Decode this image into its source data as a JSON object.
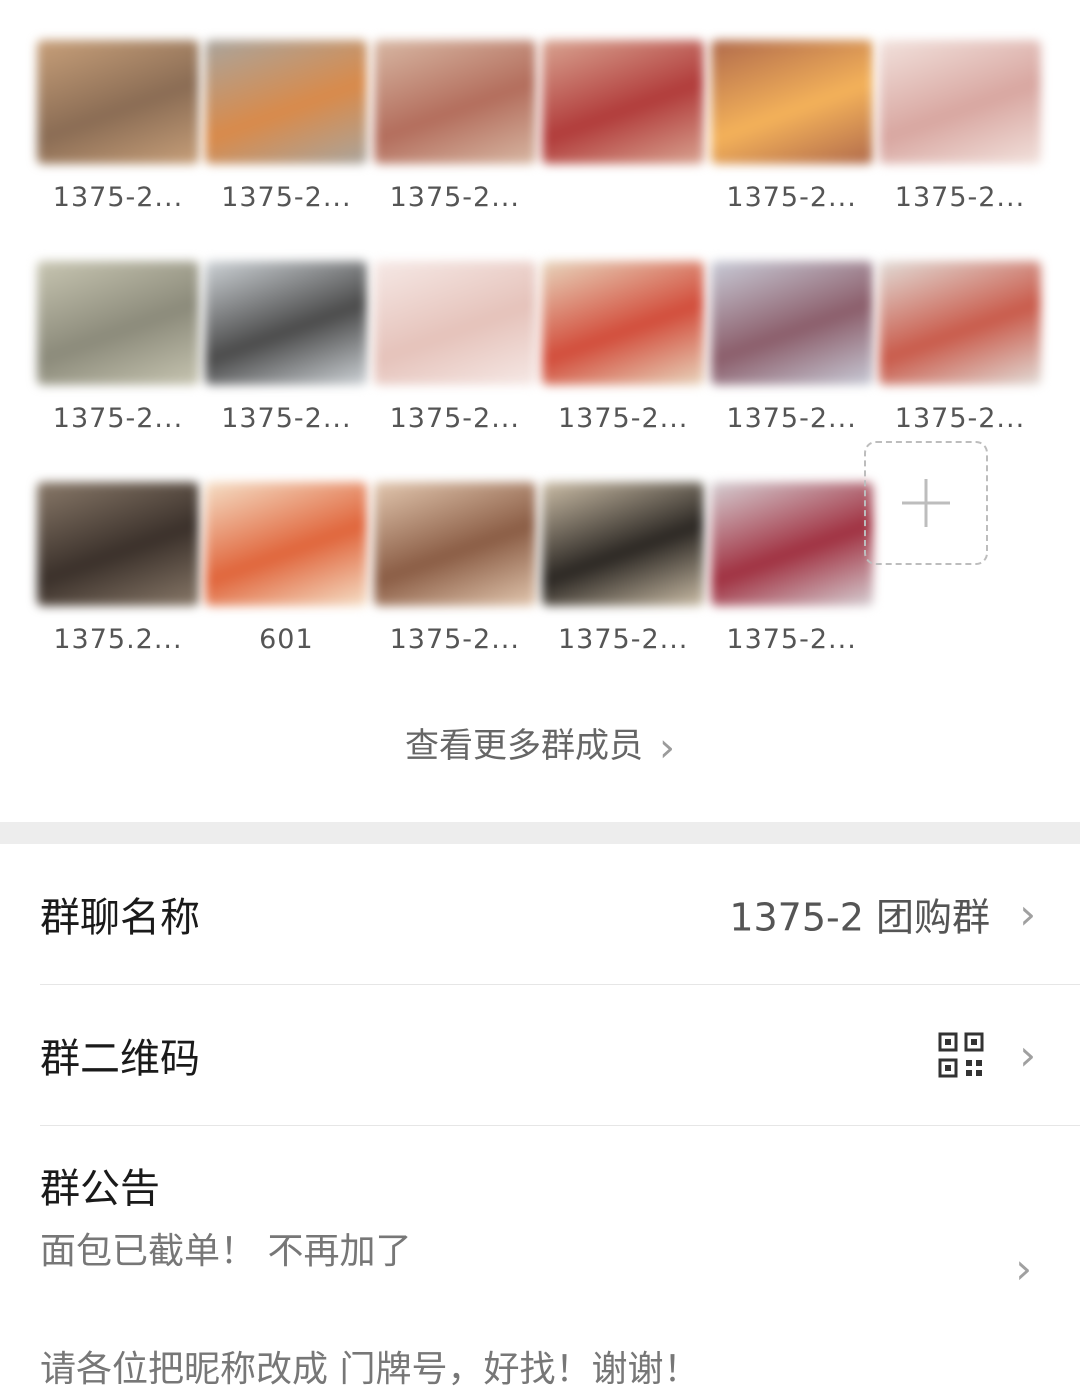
{
  "members": [
    {
      "name": "1375-2...",
      "colors": [
        "#c8a07a",
        "#8a6c54"
      ]
    },
    {
      "name": "1375-2...",
      "colors": [
        "#a9a59e",
        "#d98a4a"
      ]
    },
    {
      "name": "1375-2...",
      "colors": [
        "#d8b8a4",
        "#b36d5c"
      ]
    },
    {
      "name": "",
      "colors": [
        "#d9a592",
        "#b13b3a"
      ]
    },
    {
      "name": "1375-2...",
      "colors": [
        "#b06a4c",
        "#f4b25a"
      ]
    },
    {
      "name": "1375-2...",
      "colors": [
        "#f2e2dd",
        "#d8a6a0"
      ]
    },
    {
      "name": "1375-2...",
      "colors": [
        "#c8c6b2",
        "#8b8a7a"
      ]
    },
    {
      "name": "1375-2...",
      "colors": [
        "#cfd4d8",
        "#4a4a4a"
      ]
    },
    {
      "name": "1375-2...",
      "colors": [
        "#f6e9e6",
        "#e5c2ba"
      ]
    },
    {
      "name": "1375-2...",
      "colors": [
        "#e8d6be",
        "#d24c3a"
      ]
    },
    {
      "name": "1375-2...",
      "colors": [
        "#c9ccd8",
        "#8b5d6a"
      ]
    },
    {
      "name": "1375-2...",
      "colors": [
        "#e2ddd8",
        "#c95a4a"
      ]
    },
    {
      "name": "1375.2...",
      "colors": [
        "#8a7a6a",
        "#3a302a"
      ]
    },
    {
      "name": "601",
      "colors": [
        "#f5e0c8",
        "#e0643a"
      ]
    },
    {
      "name": "1375-2...",
      "colors": [
        "#e3c8b0",
        "#8a5c44"
      ]
    },
    {
      "name": "1375-2...",
      "colors": [
        "#cdbfa8",
        "#2a2622"
      ]
    },
    {
      "name": "1375-2...",
      "colors": [
        "#d6d0d4",
        "#a03040"
      ]
    }
  ],
  "more_members_label": "查看更多群成员",
  "group_name": {
    "label": "群聊名称",
    "value": "1375-2 团购群"
  },
  "qr_code": {
    "label": "群二维码"
  },
  "notice": {
    "label": "群公告",
    "line1": "面包已截单！  不再加了",
    "line2": "请各位把昵称改成 门牌号，好找！谢谢！"
  },
  "chevron": "›"
}
